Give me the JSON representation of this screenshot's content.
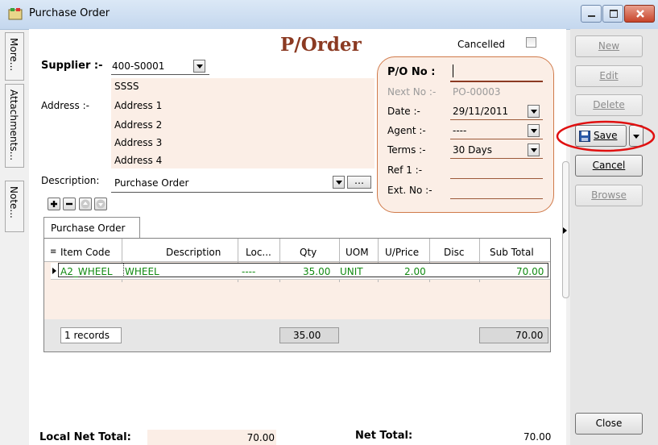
{
  "window": {
    "title": "Purchase Order"
  },
  "side_tabs": [
    "More...",
    "Attachments...",
    "Note..."
  ],
  "header": {
    "form_title": "P/Order",
    "cancelled_label": "Cancelled",
    "supplier_label": "Supplier :-",
    "supplier_code": "400-S0001",
    "supplier_name": "SSSS",
    "address_label": "Address :-",
    "address_lines": [
      "Address 1",
      "Address 2",
      "Address 3",
      "Address 4"
    ],
    "description_label": "Description:",
    "description_value": "Purchase Order",
    "description_more": "…"
  },
  "po_box": {
    "po_no_label": "P/O No :",
    "po_no_value": "",
    "next_no_label": "Next No :-",
    "next_no_value": "PO-00003",
    "date_label": "Date :-",
    "date_value": "29/11/2011",
    "agent_label": "Agent :-",
    "agent_value": "----",
    "terms_label": "Terms :-",
    "terms_value": "30 Days",
    "ref1_label": "Ref 1 :-",
    "ref1_value": "",
    "ext_no_label": "Ext. No :-",
    "ext_no_value": ""
  },
  "tab": {
    "label": "Purchase Order"
  },
  "grid": {
    "columns": [
      "Item Code",
      "Description",
      "Loc...",
      "Qty",
      "UOM",
      "U/Price",
      "Disc",
      "Sub Total"
    ],
    "rows": [
      {
        "item_code": "A2_WHEEL",
        "description": "WHEEL",
        "loc": "----",
        "qty": "35.00",
        "uom": "UNIT",
        "u_price": "2.00",
        "disc": "",
        "sub_total": "70.00"
      }
    ],
    "footer": {
      "records": "1 records",
      "qty_total": "35.00",
      "sub_total": "70.00"
    }
  },
  "totals": {
    "local_net_total_label": "Local Net Total:",
    "local_net_total_value": "70.00",
    "net_total_label": "Net Total:",
    "net_total_value": "70.00"
  },
  "buttons": {
    "new": "New",
    "edit": "Edit",
    "delete": "Delete",
    "save": "Save",
    "cancel": "Cancel",
    "browse": "Browse",
    "close": "Close"
  },
  "colors": {
    "accent_title": "#8b3a22",
    "highlight_circle": "#e01010",
    "grid_text": "#118a11"
  }
}
